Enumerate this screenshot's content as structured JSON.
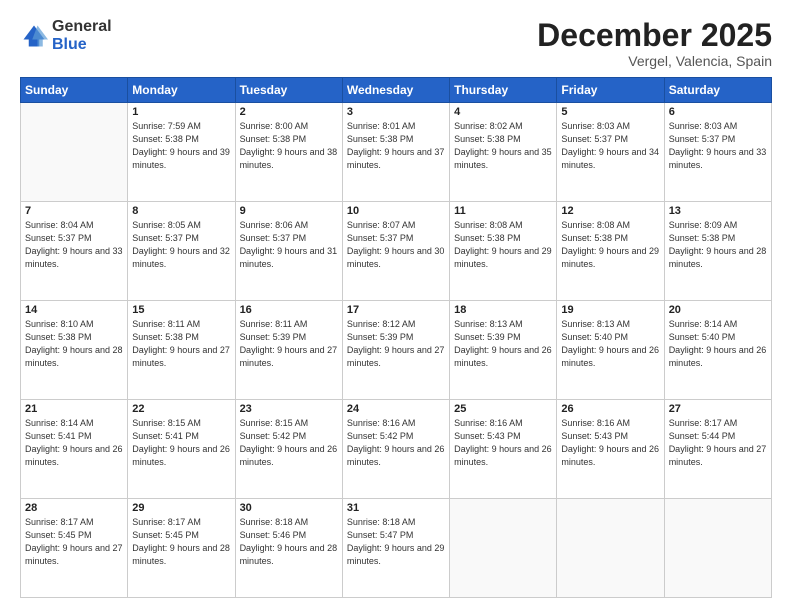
{
  "logo": {
    "general": "General",
    "blue": "Blue"
  },
  "header": {
    "month": "December 2025",
    "location": "Vergel, Valencia, Spain"
  },
  "days_of_week": [
    "Sunday",
    "Monday",
    "Tuesday",
    "Wednesday",
    "Thursday",
    "Friday",
    "Saturday"
  ],
  "weeks": [
    [
      {
        "num": "",
        "empty": true
      },
      {
        "num": "1",
        "sunrise": "Sunrise: 7:59 AM",
        "sunset": "Sunset: 5:38 PM",
        "daylight": "Daylight: 9 hours and 39 minutes."
      },
      {
        "num": "2",
        "sunrise": "Sunrise: 8:00 AM",
        "sunset": "Sunset: 5:38 PM",
        "daylight": "Daylight: 9 hours and 38 minutes."
      },
      {
        "num": "3",
        "sunrise": "Sunrise: 8:01 AM",
        "sunset": "Sunset: 5:38 PM",
        "daylight": "Daylight: 9 hours and 37 minutes."
      },
      {
        "num": "4",
        "sunrise": "Sunrise: 8:02 AM",
        "sunset": "Sunset: 5:38 PM",
        "daylight": "Daylight: 9 hours and 35 minutes."
      },
      {
        "num": "5",
        "sunrise": "Sunrise: 8:03 AM",
        "sunset": "Sunset: 5:37 PM",
        "daylight": "Daylight: 9 hours and 34 minutes."
      },
      {
        "num": "6",
        "sunrise": "Sunrise: 8:03 AM",
        "sunset": "Sunset: 5:37 PM",
        "daylight": "Daylight: 9 hours and 33 minutes."
      }
    ],
    [
      {
        "num": "7",
        "sunrise": "Sunrise: 8:04 AM",
        "sunset": "Sunset: 5:37 PM",
        "daylight": "Daylight: 9 hours and 33 minutes."
      },
      {
        "num": "8",
        "sunrise": "Sunrise: 8:05 AM",
        "sunset": "Sunset: 5:37 PM",
        "daylight": "Daylight: 9 hours and 32 minutes."
      },
      {
        "num": "9",
        "sunrise": "Sunrise: 8:06 AM",
        "sunset": "Sunset: 5:37 PM",
        "daylight": "Daylight: 9 hours and 31 minutes."
      },
      {
        "num": "10",
        "sunrise": "Sunrise: 8:07 AM",
        "sunset": "Sunset: 5:37 PM",
        "daylight": "Daylight: 9 hours and 30 minutes."
      },
      {
        "num": "11",
        "sunrise": "Sunrise: 8:08 AM",
        "sunset": "Sunset: 5:38 PM",
        "daylight": "Daylight: 9 hours and 29 minutes."
      },
      {
        "num": "12",
        "sunrise": "Sunrise: 8:08 AM",
        "sunset": "Sunset: 5:38 PM",
        "daylight": "Daylight: 9 hours and 29 minutes."
      },
      {
        "num": "13",
        "sunrise": "Sunrise: 8:09 AM",
        "sunset": "Sunset: 5:38 PM",
        "daylight": "Daylight: 9 hours and 28 minutes."
      }
    ],
    [
      {
        "num": "14",
        "sunrise": "Sunrise: 8:10 AM",
        "sunset": "Sunset: 5:38 PM",
        "daylight": "Daylight: 9 hours and 28 minutes."
      },
      {
        "num": "15",
        "sunrise": "Sunrise: 8:11 AM",
        "sunset": "Sunset: 5:38 PM",
        "daylight": "Daylight: 9 hours and 27 minutes."
      },
      {
        "num": "16",
        "sunrise": "Sunrise: 8:11 AM",
        "sunset": "Sunset: 5:39 PM",
        "daylight": "Daylight: 9 hours and 27 minutes."
      },
      {
        "num": "17",
        "sunrise": "Sunrise: 8:12 AM",
        "sunset": "Sunset: 5:39 PM",
        "daylight": "Daylight: 9 hours and 27 minutes."
      },
      {
        "num": "18",
        "sunrise": "Sunrise: 8:13 AM",
        "sunset": "Sunset: 5:39 PM",
        "daylight": "Daylight: 9 hours and 26 minutes."
      },
      {
        "num": "19",
        "sunrise": "Sunrise: 8:13 AM",
        "sunset": "Sunset: 5:40 PM",
        "daylight": "Daylight: 9 hours and 26 minutes."
      },
      {
        "num": "20",
        "sunrise": "Sunrise: 8:14 AM",
        "sunset": "Sunset: 5:40 PM",
        "daylight": "Daylight: 9 hours and 26 minutes."
      }
    ],
    [
      {
        "num": "21",
        "sunrise": "Sunrise: 8:14 AM",
        "sunset": "Sunset: 5:41 PM",
        "daylight": "Daylight: 9 hours and 26 minutes."
      },
      {
        "num": "22",
        "sunrise": "Sunrise: 8:15 AM",
        "sunset": "Sunset: 5:41 PM",
        "daylight": "Daylight: 9 hours and 26 minutes."
      },
      {
        "num": "23",
        "sunrise": "Sunrise: 8:15 AM",
        "sunset": "Sunset: 5:42 PM",
        "daylight": "Daylight: 9 hours and 26 minutes."
      },
      {
        "num": "24",
        "sunrise": "Sunrise: 8:16 AM",
        "sunset": "Sunset: 5:42 PM",
        "daylight": "Daylight: 9 hours and 26 minutes."
      },
      {
        "num": "25",
        "sunrise": "Sunrise: 8:16 AM",
        "sunset": "Sunset: 5:43 PM",
        "daylight": "Daylight: 9 hours and 26 minutes."
      },
      {
        "num": "26",
        "sunrise": "Sunrise: 8:16 AM",
        "sunset": "Sunset: 5:43 PM",
        "daylight": "Daylight: 9 hours and 26 minutes."
      },
      {
        "num": "27",
        "sunrise": "Sunrise: 8:17 AM",
        "sunset": "Sunset: 5:44 PM",
        "daylight": "Daylight: 9 hours and 27 minutes."
      }
    ],
    [
      {
        "num": "28",
        "sunrise": "Sunrise: 8:17 AM",
        "sunset": "Sunset: 5:45 PM",
        "daylight": "Daylight: 9 hours and 27 minutes."
      },
      {
        "num": "29",
        "sunrise": "Sunrise: 8:17 AM",
        "sunset": "Sunset: 5:45 PM",
        "daylight": "Daylight: 9 hours and 28 minutes."
      },
      {
        "num": "30",
        "sunrise": "Sunrise: 8:18 AM",
        "sunset": "Sunset: 5:46 PM",
        "daylight": "Daylight: 9 hours and 28 minutes."
      },
      {
        "num": "31",
        "sunrise": "Sunrise: 8:18 AM",
        "sunset": "Sunset: 5:47 PM",
        "daylight": "Daylight: 9 hours and 29 minutes."
      },
      {
        "num": "",
        "empty": true
      },
      {
        "num": "",
        "empty": true
      },
      {
        "num": "",
        "empty": true
      }
    ]
  ]
}
